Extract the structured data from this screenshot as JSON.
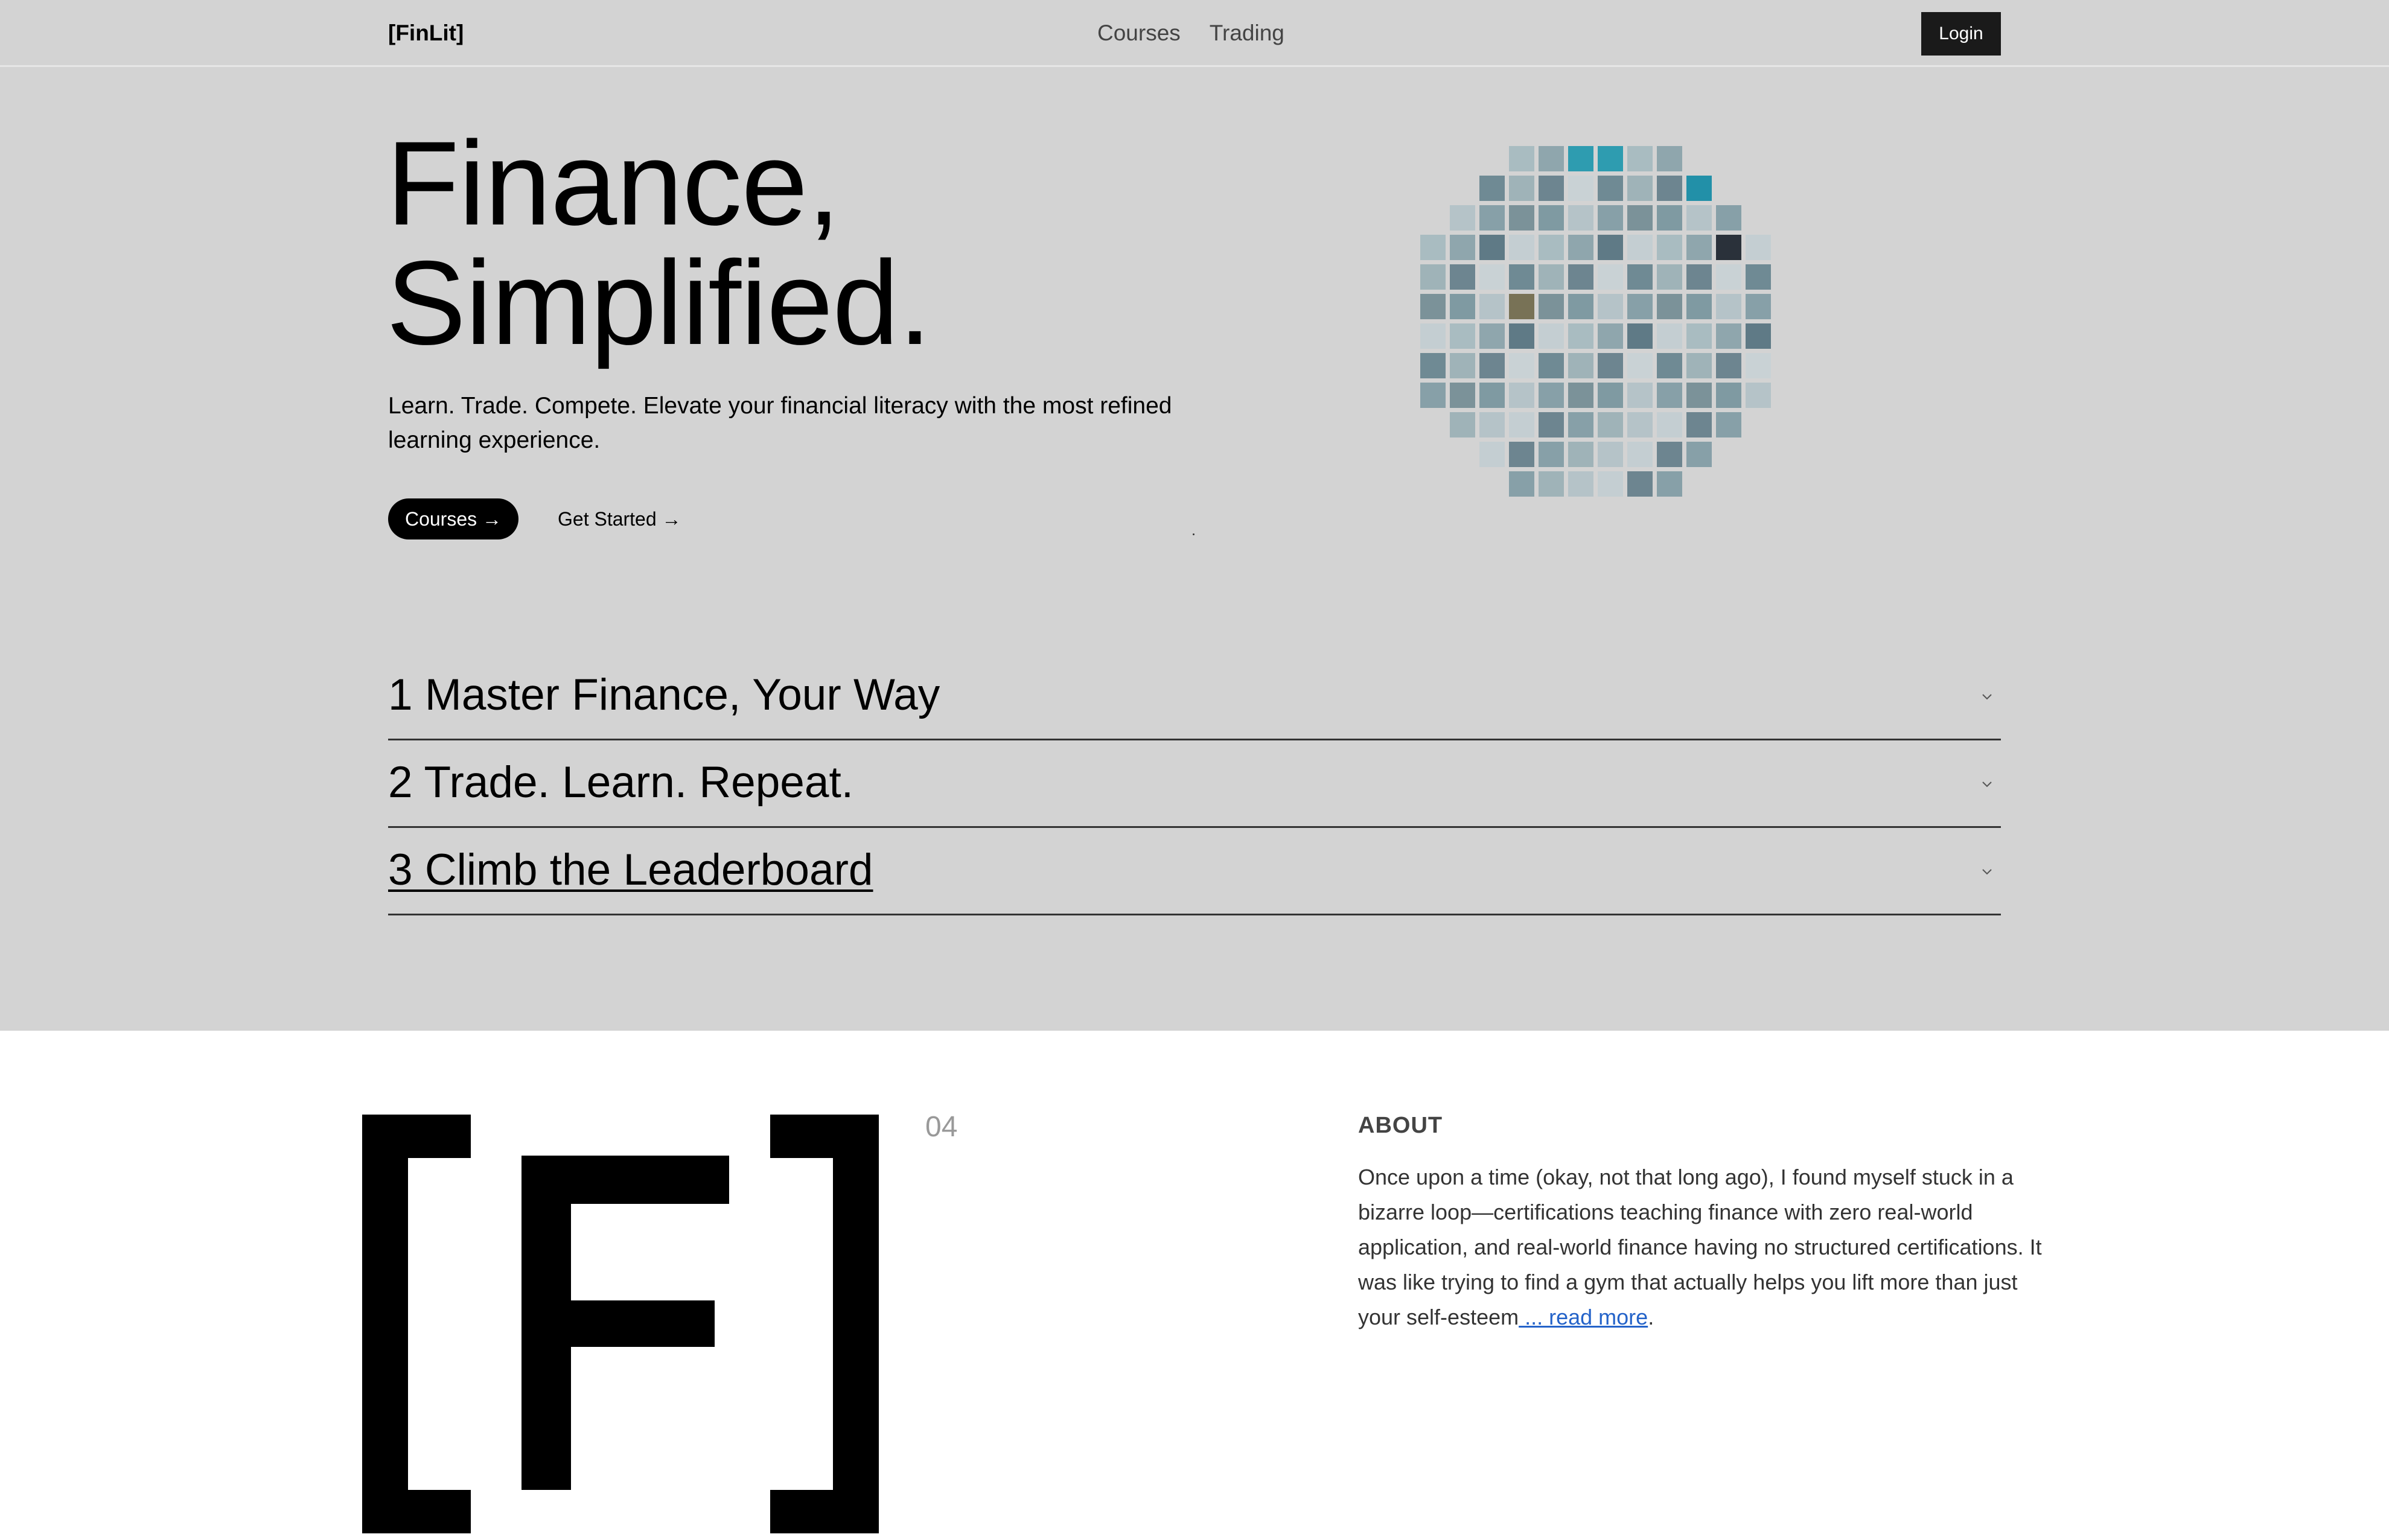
{
  "header": {
    "brand": "[FinLit]",
    "nav": [
      "Courses",
      "Trading"
    ],
    "login_label": "Login"
  },
  "hero": {
    "title_line1": "Finance,",
    "title_line2": "Simplified.",
    "subtitle": "Learn. Trade. Compete. Elevate your financial literacy with the most refined learning experience.",
    "primary_button": "Courses →",
    "secondary_button": "Get Started →"
  },
  "accordion": [
    {
      "label": "1 Master Finance, Your Way"
    },
    {
      "label": "2 Trade. Learn. Repeat."
    },
    {
      "label": "3 Climb the Leaderboard"
    }
  ],
  "about": {
    "section_number": "04",
    "heading": "ABOUT",
    "body": "Once upon a time (okay, not that long ago), I found myself stuck in a bizarre loop—certifications teaching finance with zero real-world application, and real-world finance having no structured certifications. It was like trying to find a gym that actually helps you lift more than just your self-esteem",
    "read_more": " ... read more",
    "trailing": "."
  },
  "colors": {
    "hero_bg": "#d3d3d3",
    "accent_teal": "#2e9cb0",
    "link_blue": "#2463c9"
  }
}
